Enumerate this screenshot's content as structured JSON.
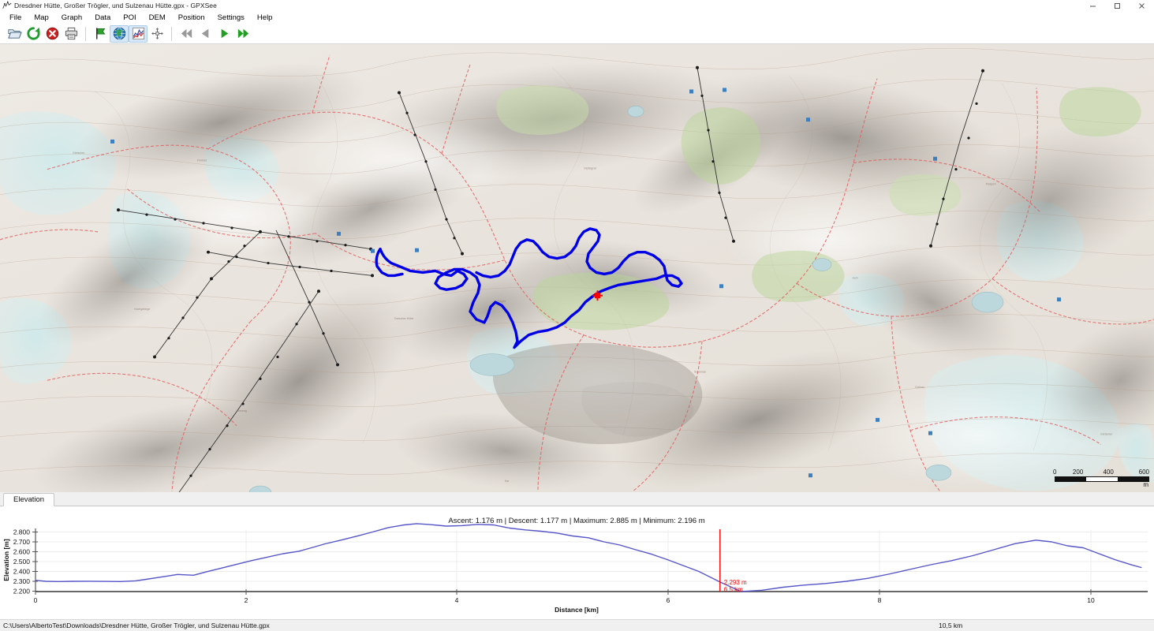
{
  "window": {
    "title": "Dresdner Hütte, Großer Trögler, und Sulzenau Hütte.gpx - GPXSee",
    "app_icon": "track-icon",
    "minimize_label": "─",
    "maximize_label": "☐",
    "close_label": "✕"
  },
  "menu": {
    "items": [
      {
        "label": "File"
      },
      {
        "label": "Map"
      },
      {
        "label": "Graph"
      },
      {
        "label": "Data"
      },
      {
        "label": "POI"
      },
      {
        "label": "DEM"
      },
      {
        "label": "Position"
      },
      {
        "label": "Settings"
      },
      {
        "label": "Help"
      }
    ]
  },
  "toolbar": {
    "groups": [
      {
        "buttons": [
          {
            "name": "open-file-button",
            "icon": "open-folder-icon",
            "tooltip": "Open",
            "active": false
          },
          {
            "name": "reload-button",
            "icon": "reload-icon",
            "tooltip": "Reload",
            "active": false
          },
          {
            "name": "close-file-button",
            "icon": "close-circle-icon",
            "tooltip": "Close",
            "active": false
          },
          {
            "name": "print-button",
            "icon": "printer-icon",
            "tooltip": "Print",
            "active": false
          }
        ]
      },
      {
        "buttons": [
          {
            "name": "show-waypoints-button",
            "icon": "flag-icon",
            "tooltip": "Waypoints",
            "active": false
          },
          {
            "name": "show-map-button",
            "icon": "globe-icon",
            "tooltip": "Show map",
            "active": true
          },
          {
            "name": "show-graphs-button",
            "icon": "graph-icon",
            "tooltip": "Show graphs",
            "active": true
          },
          {
            "name": "fullscreen-button",
            "icon": "move-arrows-icon",
            "tooltip": "Fullscreen",
            "active": false
          }
        ]
      },
      {
        "buttons": [
          {
            "name": "first-track-button",
            "icon": "skip-back-icon",
            "tooltip": "First",
            "active": false
          },
          {
            "name": "previous-track-button",
            "icon": "play-back-icon",
            "tooltip": "Previous",
            "active": false
          },
          {
            "name": "next-track-button",
            "icon": "play-forward-icon",
            "tooltip": "Next",
            "active": false
          },
          {
            "name": "last-track-button",
            "icon": "skip-forward-icon",
            "tooltip": "Last",
            "active": false
          }
        ]
      }
    ]
  },
  "map": {
    "scale_bar": {
      "labels": [
        "0",
        "200",
        "400",
        "600"
      ],
      "unit": "m"
    },
    "track_color": "#0000e6",
    "marker_color": "#ff0000"
  },
  "tabs": [
    {
      "label": "Elevation",
      "active": true
    }
  ],
  "graph": {
    "stats": "Ascent: 1.176 m | Descent: 1.177 m | Maximum: 2.885 m | Minimum: 2.196 m",
    "ylabel": "Elevation [m]",
    "xlabel": "Distance [km]",
    "yticks": [
      "2.200",
      "2.300",
      "2.400",
      "2.500",
      "2.600",
      "2.700",
      "2.800"
    ],
    "xticks": [
      "0",
      "2",
      "4",
      "6",
      "8",
      "10"
    ],
    "marker": {
      "elevation": "2.293 m",
      "distance": "6,5 km"
    },
    "line_color": "#5555c8"
  },
  "statusbar": {
    "file_path": "C:\\Users\\AlbertoTest\\Downloads\\Dresdner Hütte, Großer Trögler, und Sulzenau Hütte.gpx",
    "total_distance": "10,5 km"
  },
  "chart_data": {
    "type": "line",
    "title": "Elevation",
    "xlabel": "Distance [km]",
    "ylabel": "Elevation [m]",
    "xlim": [
      0,
      10.5
    ],
    "ylim": [
      2200,
      2885
    ],
    "grid": true,
    "legend": false,
    "annotations": [
      {
        "x": 6.5,
        "y": 2293,
        "labels": [
          "2.293 m",
          "6,5 km"
        ],
        "color": "#ff0000"
      }
    ],
    "series": [
      {
        "name": "Elevation",
        "color": "#5555c8",
        "x": [
          0.0,
          0.1,
          0.22,
          0.35,
          0.5,
          0.65,
          0.8,
          0.95,
          1.05,
          1.2,
          1.35,
          1.5,
          1.62,
          1.75,
          1.9,
          2.05,
          2.2,
          2.35,
          2.5,
          2.62,
          2.75,
          2.9,
          3.05,
          3.2,
          3.35,
          3.5,
          3.62,
          3.75,
          3.9,
          4.05,
          4.2,
          4.35,
          4.5,
          4.65,
          4.8,
          4.95,
          5.1,
          5.25,
          5.4,
          5.55,
          5.7,
          5.85,
          6.0,
          6.15,
          6.3,
          6.5,
          6.7,
          6.9,
          7.1,
          7.3,
          7.5,
          7.7,
          7.9,
          8.1,
          8.3,
          8.5,
          8.7,
          8.9,
          9.1,
          9.3,
          9.5,
          9.65,
          9.8,
          9.95,
          10.1,
          10.25,
          10.4,
          10.5
        ],
        "y": [
          2310,
          2300,
          2298,
          2300,
          2301,
          2299,
          2298,
          2305,
          2320,
          2345,
          2370,
          2362,
          2395,
          2430,
          2470,
          2510,
          2545,
          2580,
          2605,
          2640,
          2680,
          2718,
          2758,
          2800,
          2845,
          2872,
          2885,
          2875,
          2860,
          2865,
          2878,
          2872,
          2840,
          2822,
          2808,
          2790,
          2760,
          2742,
          2700,
          2668,
          2620,
          2575,
          2520,
          2460,
          2400,
          2293,
          2196,
          2210,
          2240,
          2262,
          2278,
          2300,
          2330,
          2372,
          2420,
          2468,
          2510,
          2560,
          2620,
          2682,
          2718,
          2700,
          2660,
          2640,
          2580,
          2520,
          2470,
          2440
        ]
      }
    ]
  }
}
